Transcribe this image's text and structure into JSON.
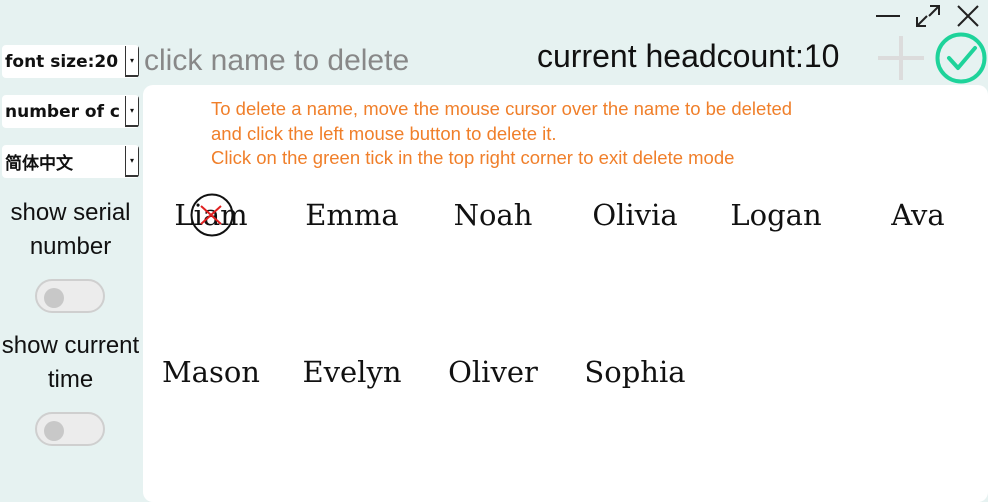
{
  "window": {
    "controls": [
      "minimize-icon",
      "maximize-icon",
      "close-icon"
    ]
  },
  "sidebar": {
    "font_size": "font size:20",
    "columns": "number of c",
    "language": "简体中文",
    "show_serial_label": "show serial number",
    "show_serial_on": false,
    "show_time_label": "show current time",
    "show_time_on": false
  },
  "header": {
    "hint": "click name to delete",
    "headcount_label": "current headcount:",
    "headcount_value": "10",
    "add_icon": "plus-icon",
    "confirm_icon": "check-circle-icon"
  },
  "instructions": [
    "To delete a name, move the mouse cursor over the name to be deleted",
    "and click the left mouse button to delete it.",
    "Click on the green tick in the top right corner to exit delete mode"
  ],
  "names": [
    "Liam",
    "Emma",
    "Noah",
    "Olivia",
    "Logan",
    "Ava",
    "Mason",
    "Evelyn",
    "Oliver",
    "Sophia"
  ],
  "colors": {
    "background": "#e6f2f1",
    "accent_green": "#1ed39a",
    "instruction_orange": "#f07f2a",
    "delete_red": "#e02020"
  }
}
